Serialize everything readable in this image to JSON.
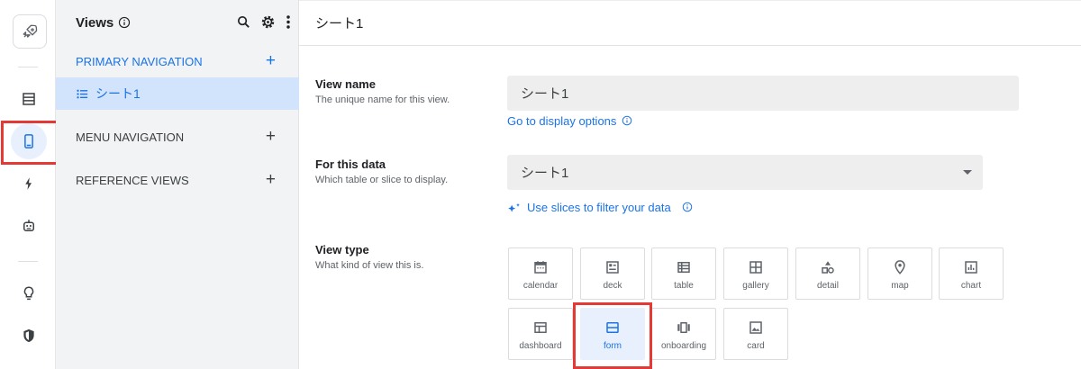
{
  "rail": {
    "items": [
      "logo",
      "data",
      "views",
      "automation",
      "bots",
      "ideas",
      "security"
    ]
  },
  "sidebar": {
    "title": "Views",
    "sections": {
      "primary": "PRIMARY NAVIGATION",
      "menu": "MENU NAVIGATION",
      "reference": "REFERENCE VIEWS"
    },
    "plus": "+",
    "selected_item": "シート1"
  },
  "main": {
    "header_title": "シート1",
    "view_name": {
      "title": "View name",
      "desc": "The unique name for this view.",
      "value": "シート1",
      "link": "Go to display options"
    },
    "for_this_data": {
      "title": "For this data",
      "desc": "Which table or slice to display.",
      "value": "シート1",
      "link": "Use slices to filter your data"
    },
    "view_type": {
      "title": "View type",
      "desc": "What kind of view this is.",
      "options": [
        "calendar",
        "deck",
        "table",
        "gallery",
        "detail",
        "map",
        "chart",
        "dashboard",
        "form",
        "onboarding",
        "card"
      ],
      "selected": "form"
    }
  },
  "colors": {
    "accent": "#1a73e8",
    "highlight_box": "#e53935",
    "selected_bg": "#d2e3fc"
  }
}
